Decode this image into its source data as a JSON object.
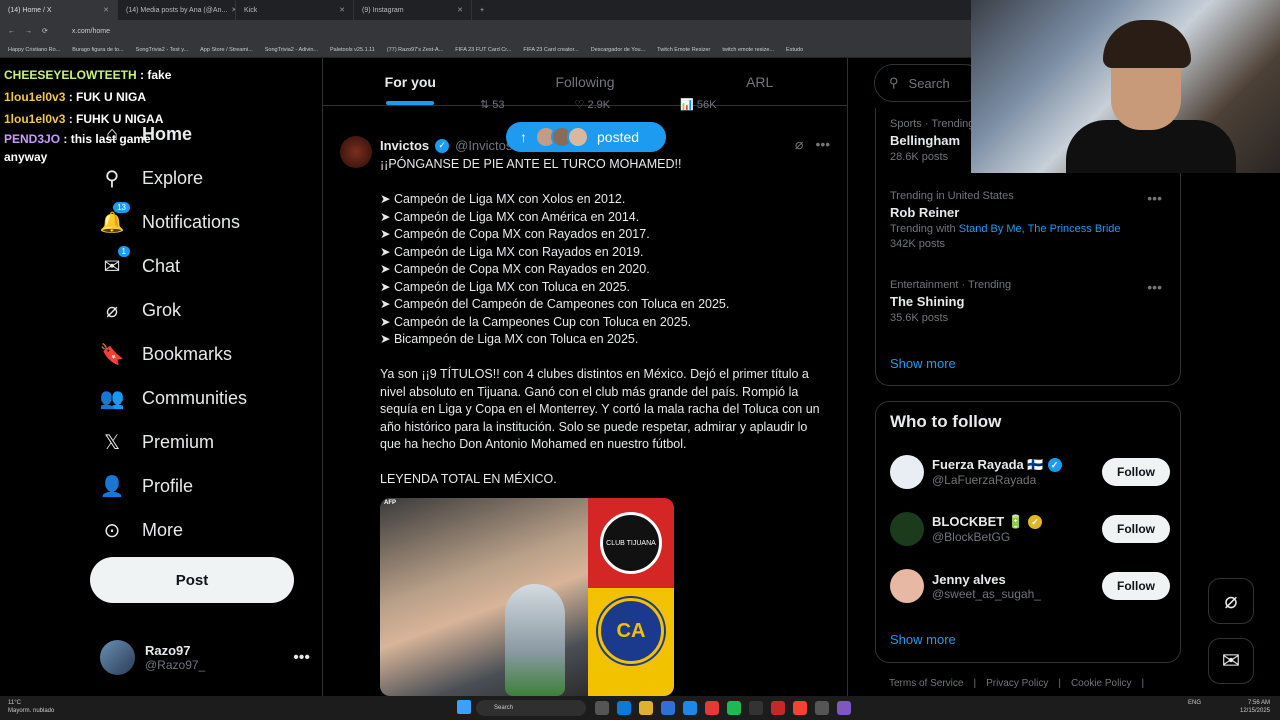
{
  "browser": {
    "tabs": [
      {
        "label": "(14) Home / X",
        "active": true
      },
      {
        "label": "(14) Media posts by Ana (@An...",
        "active": false
      },
      {
        "label": "Kick",
        "active": false
      },
      {
        "label": "(9) Instagram",
        "active": false
      }
    ],
    "url": "x.com/home",
    "bookmarks": [
      "Happy Cristiano Ro...",
      "Burago figura de to...",
      "SongTrivia2 - Test y...",
      "App Store / Streami...",
      "SongTrivia2 - Adivin...",
      "Paletools v25.1.11",
      "(77) Razo97's Zest-A...",
      "FIFA 23 FUT Card Cr...",
      "FIFA 23 Card creator...",
      "Descargador de You...",
      "Twitch Emote Resizer",
      "twitch emote resize...",
      "Estudo"
    ]
  },
  "stream_chat": [
    {
      "user": "CHEESEYELOWTEETH",
      "msg": ": fake"
    },
    {
      "user": "1lou1el0v3",
      "msg": ": FUK U NIGA"
    },
    {
      "user": "1lou1el0v3",
      "msg": ": FUHK U NIGAA"
    },
    {
      "user": "PEND3JO",
      "msg": ": this last game anyway"
    }
  ],
  "nav": {
    "home": "Home",
    "explore": "Explore",
    "notifications": "Notifications",
    "notifications_badge": "13",
    "chat": "Chat",
    "chat_badge": "1",
    "grok": "Grok",
    "bookmarks": "Bookmarks",
    "communities": "Communities",
    "premium": "Premium",
    "profile": "Profile",
    "more": "More",
    "post": "Post"
  },
  "account": {
    "name": "Razo97",
    "handle": "@Razo97_"
  },
  "feed_tabs": [
    {
      "label": "For you",
      "active": true
    },
    {
      "label": "Following",
      "active": false
    },
    {
      "label": "ARL",
      "active": false
    }
  ],
  "prev_post_stats": {
    "replies": "53",
    "likes": "2.9K",
    "views": "56K"
  },
  "posted_pill": "posted",
  "tweet": {
    "name": "Invictos",
    "handle": "@Invictos",
    "headline": "¡¡PÓNGANSE DE PIE ANTE EL TURCO MOHAMED!!",
    "list": [
      "➤ Campeón de Liga MX con Xolos en 2012.",
      "➤ Campeón de Liga MX con América en 2014.",
      "➤ Campeón de Copa MX con Rayados en 2017.",
      "➤ Campeón de Liga MX con Rayados en 2019.",
      "➤ Campeón de Copa MX con Rayados en 2020.",
      "➤ Campeón de Liga MX con Toluca en 2025.",
      "➤ Campeón del Campeón de Campeones con Toluca en 2025.",
      "➤ Campeón de la Campeones Cup con Toluca en 2025.",
      "➤ Bicampeón de Liga MX con Toluca en 2025."
    ],
    "paragraph": "Ya son ¡¡9 TÍTULOS!! con 4 clubes distintos en México. Dejó el primer título a nivel absoluto en Tijuana. Ganó con el club más grande del país. Rompió la sequía en Liga y Copa en el Monterrey. Y cortó la mala racha del Toluca con un año histórico para la institución. Solo se puede respetar, admirar y aplaudir lo que ha hecho Don Antonio Mohamed en nuestro fútbol.",
    "closing": "LEYENDA TOTAL EN MÉXICO.",
    "image_tag": "AFP",
    "crest_top": "CLUB TIJUANA",
    "crest_bottom": "CA"
  },
  "search": {
    "placeholder": "Search"
  },
  "trends": [
    {
      "meta": "Sports · Trending",
      "topic": "Bellingham",
      "count": "28.6K posts",
      "with": ""
    },
    {
      "meta": "Trending in United States",
      "topic": "Rob Reiner",
      "count": "342K posts",
      "with_prefix": "Trending with",
      "with": "Stand By Me, The Princess Bride"
    },
    {
      "meta": "Entertainment · Trending",
      "topic": "The Shining",
      "count": "35.6K posts",
      "with": ""
    }
  ],
  "trends_show_more": "Show more",
  "who_to_follow": {
    "title": "Who to follow",
    "accounts": [
      {
        "name": "Fuerza Rayada 🇫🇮",
        "handle": "@LaFuerzaRayada",
        "button": "Follow",
        "avatar_color": "#e8eef4"
      },
      {
        "name": "BLOCKBET 🔋",
        "handle": "@BlockBetGG",
        "button": "Follow",
        "avatar_color": "#1c3a1c"
      },
      {
        "name": "Jenny alves",
        "handle": "@sweet_as_sugah_",
        "button": "Follow",
        "avatar_color": "#e7b9a4"
      }
    ],
    "show_more": "Show more"
  },
  "footer": [
    "Terms of Service",
    "Privacy Policy",
    "Cookie Policy"
  ],
  "taskbar": {
    "weather_temp": "11°C",
    "weather_desc": "Mayorm. nublado",
    "search": "Search",
    "lang": "ENG",
    "time": "7:56 AM",
    "date": "12/15/2025"
  },
  "colors": {
    "accent": "#1d9bf0",
    "background": "#000000",
    "text": "#e7e9ea",
    "muted": "#71767b"
  }
}
